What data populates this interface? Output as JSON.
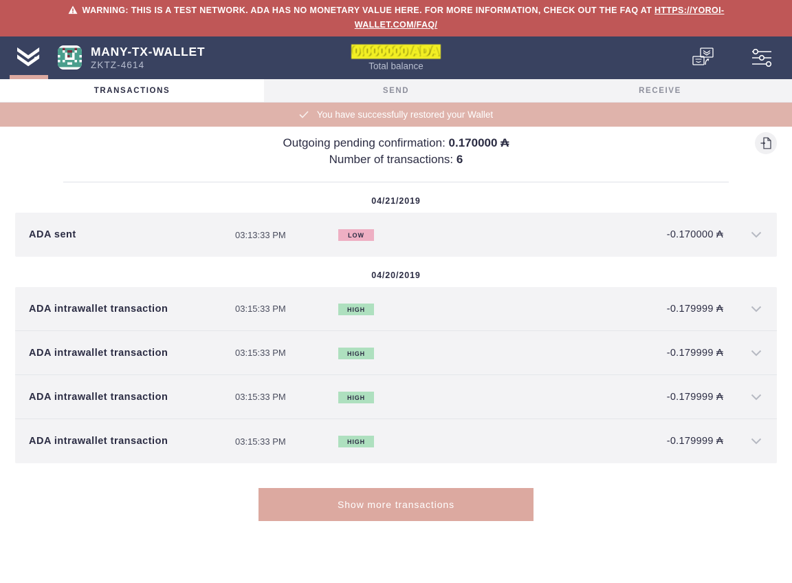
{
  "warning": {
    "icon": "warning-triangle-icon",
    "text": "WARNING: THIS IS A TEST NETWORK. ADA HAS NO MONETARY VALUE HERE. FOR MORE INFORMATION, CHECK OUT THE FAQ AT ",
    "link_text": "HTTPS://YOROI-WALLET.COM/FAQ/",
    "bg_color": "#bf5757"
  },
  "topbar": {
    "logo_icon": "yoroi-logo-icon",
    "wallet": {
      "avatar_icon": "wallet-identicon-avatar",
      "name": "MANY-TX-WALLET",
      "plate_id": "ZKTZ-4614"
    },
    "balance": {
      "amount": "0.000000 ADA",
      "label": "Total balance",
      "highlight_color": "#f2ef23"
    },
    "actions": [
      {
        "icon": "wallet-switch-icon",
        "name": "switch-wallet-button"
      },
      {
        "icon": "settings-sliders-icon",
        "name": "settings-button"
      }
    ],
    "bg_color": "#394260",
    "active_indicator_color": "#dca9a0"
  },
  "tabs": [
    {
      "label": "TRANSACTIONS",
      "active": true
    },
    {
      "label": "SEND",
      "active": false
    },
    {
      "label": "RECEIVE",
      "active": false
    }
  ],
  "notification": {
    "icon": "checkmark-icon",
    "text": "You have successfully restored your Wallet",
    "bg_color": "#dfb3ab"
  },
  "summary": {
    "pending_label": "Outgoing pending confirmation:",
    "pending_value": "0.170000 ₳",
    "count_label": "Number of transactions:",
    "count_value": "6",
    "export_icon": "export-document-icon"
  },
  "transaction_groups": [
    {
      "date": "04/21/2019",
      "rows": [
        {
          "type": "ADA sent",
          "time": "03:13:33 PM",
          "badge": "LOW",
          "badge_level": "low",
          "amount": "-0.170000 ₳",
          "chevron": "chevron-down-icon"
        }
      ]
    },
    {
      "date": "04/20/2019",
      "rows": [
        {
          "type": "ADA intrawallet transaction",
          "time": "03:15:33 PM",
          "badge": "HIGH",
          "badge_level": "high",
          "amount": "-0.179999 ₳",
          "chevron": "chevron-down-icon"
        },
        {
          "type": "ADA intrawallet transaction",
          "time": "03:15:33 PM",
          "badge": "HIGH",
          "badge_level": "high",
          "amount": "-0.179999 ₳",
          "chevron": "chevron-down-icon"
        },
        {
          "type": "ADA intrawallet transaction",
          "time": "03:15:33 PM",
          "badge": "HIGH",
          "badge_level": "high",
          "amount": "-0.179999 ₳",
          "chevron": "chevron-down-icon"
        },
        {
          "type": "ADA intrawallet transaction",
          "time": "03:15:33 PM",
          "badge": "HIGH",
          "badge_level": "high",
          "amount": "-0.179999 ₳",
          "chevron": "chevron-down-icon"
        }
      ]
    }
  ],
  "show_more": {
    "label": "Show more transactions",
    "bg_color": "#dca9a0"
  }
}
